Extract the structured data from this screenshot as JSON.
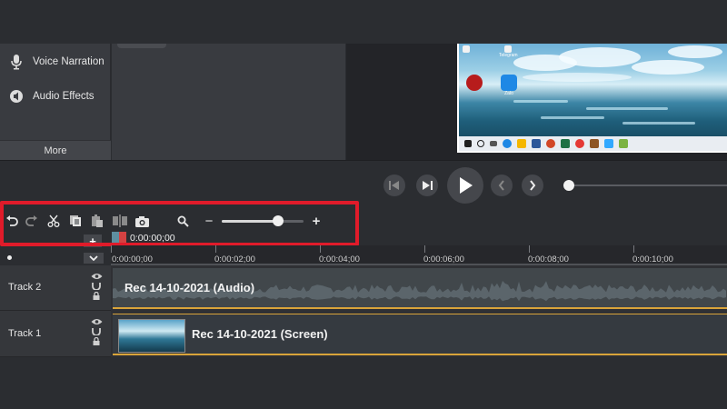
{
  "left_panel": {
    "items": [
      {
        "label": "Voice Narration",
        "icon": "microphone-icon"
      },
      {
        "label": "Audio Effects",
        "icon": "speaker-icon"
      }
    ],
    "more_label": "More"
  },
  "preview": {
    "desktop_icons": [
      "Telegram",
      "Zalo"
    ]
  },
  "toolbar": {
    "icons": [
      "undo-icon",
      "redo-icon",
      "cut-icon",
      "copy-icon",
      "paste-icon",
      "split-icon",
      "camera-icon",
      "magnifier-icon"
    ],
    "zoom_minus": "−",
    "zoom_plus": "+",
    "zoom_level": 0.69
  },
  "timeline": {
    "add_track_label": "+",
    "timecode": "0:00:00;00",
    "ruler_ticks": [
      "0:00:00;00",
      "0:00:02;00",
      "0:00:04;00",
      "0:00:06;00",
      "0:00:08;00",
      "0:00:10;00"
    ],
    "tracks": [
      {
        "name": "Track 2",
        "clip_label": "Rec 14-10-2021 (Audio)"
      },
      {
        "name": "Track 1",
        "clip_label": "Rec 14-10-2021 (Screen)"
      }
    ]
  },
  "colors": {
    "highlight": "#e01b2a",
    "clip_border": "#d9a43a",
    "playhead_red": "#d44242"
  }
}
